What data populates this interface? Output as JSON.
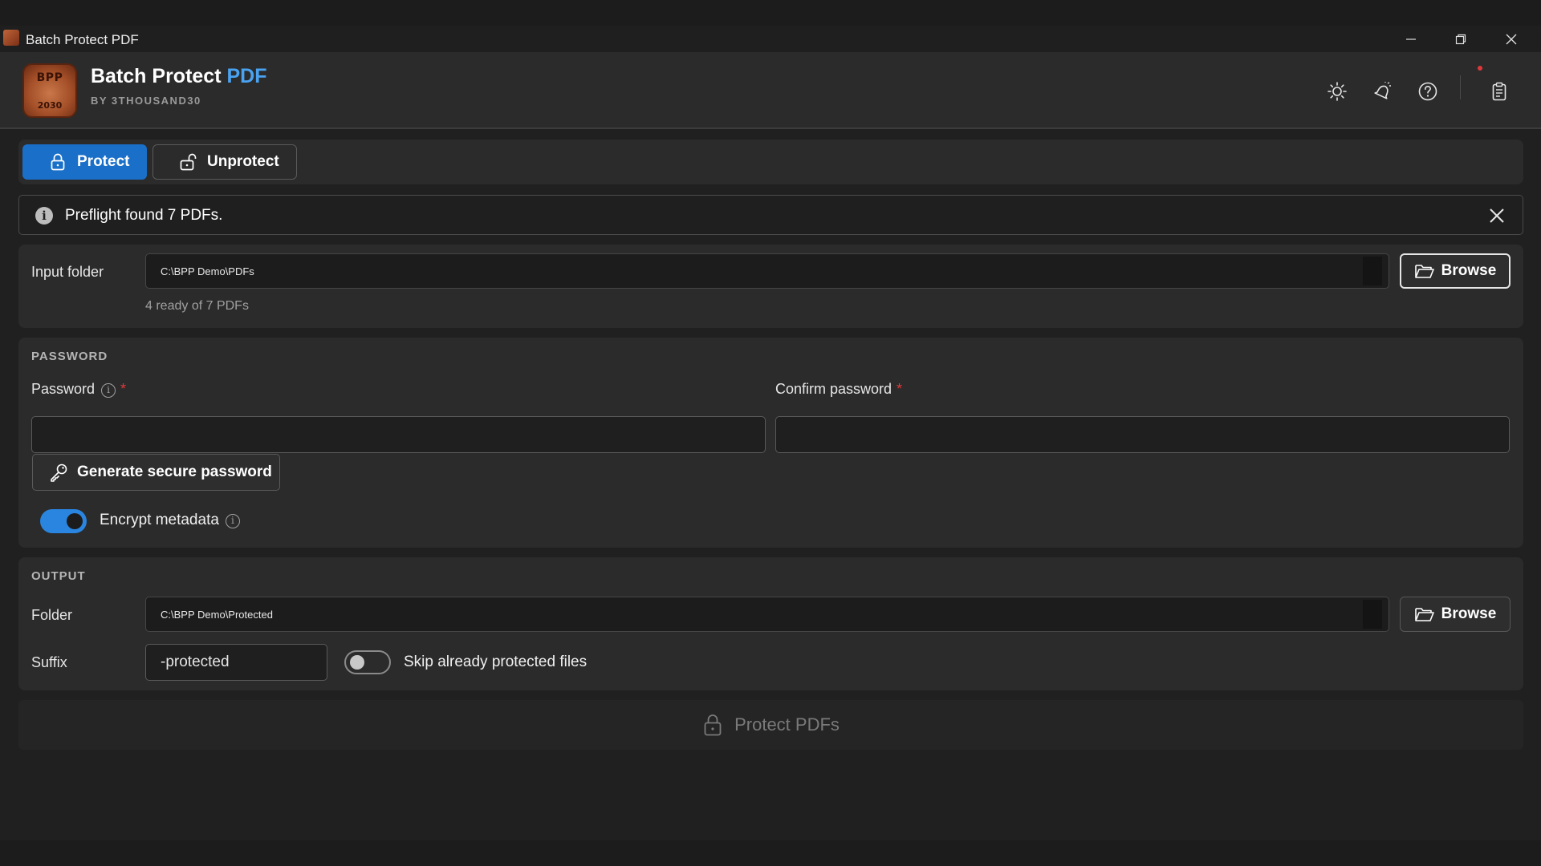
{
  "window": {
    "title": "Batch Protect PDF"
  },
  "header": {
    "app_name_main": "Batch Protect",
    "app_name_accent": "PDF",
    "byline": "BY 3THOUSAND30",
    "logo_top_text": "BPP",
    "logo_bottom_text": "2030",
    "icons": [
      "sun-icon",
      "notifications-icon",
      "help-icon",
      "clipboard-icon"
    ]
  },
  "tabs": [
    {
      "label": "Protect",
      "active": true,
      "icon": "lock-icon"
    },
    {
      "label": "Unprotect",
      "active": false,
      "icon": "unlock-icon"
    }
  ],
  "infobar": {
    "message": "Preflight found 7 PDFs."
  },
  "input": {
    "label": "Input folder",
    "path": "C:\\BPP Demo\\PDFs",
    "browse_label": "Browse",
    "status": "4 ready of 7 PDFs"
  },
  "password": {
    "section_title": "PASSWORD",
    "password_label": "Password",
    "confirm_label": "Confirm password",
    "required_mark": "*",
    "password_value": "",
    "confirm_value": "",
    "generate_label": "Generate secure password",
    "encrypt_metadata_label": "Encrypt metadata",
    "encrypt_metadata_on": true
  },
  "output": {
    "section_title": "OUTPUT",
    "folder_label": "Folder",
    "folder_path": "C:\\BPP Demo\\Protected",
    "browse_label": "Browse",
    "suffix_label": "Suffix",
    "suffix_value": "-protected",
    "skip_label": "Skip already protected files",
    "skip_on": false
  },
  "action": {
    "run_label": "Protect PDFs",
    "enabled": false
  },
  "colors": {
    "accent": "#1a6fc8",
    "accent_text": "#4aa3f2",
    "required": "#e0383a",
    "background": "#202020",
    "card": "#2b2b2b"
  }
}
